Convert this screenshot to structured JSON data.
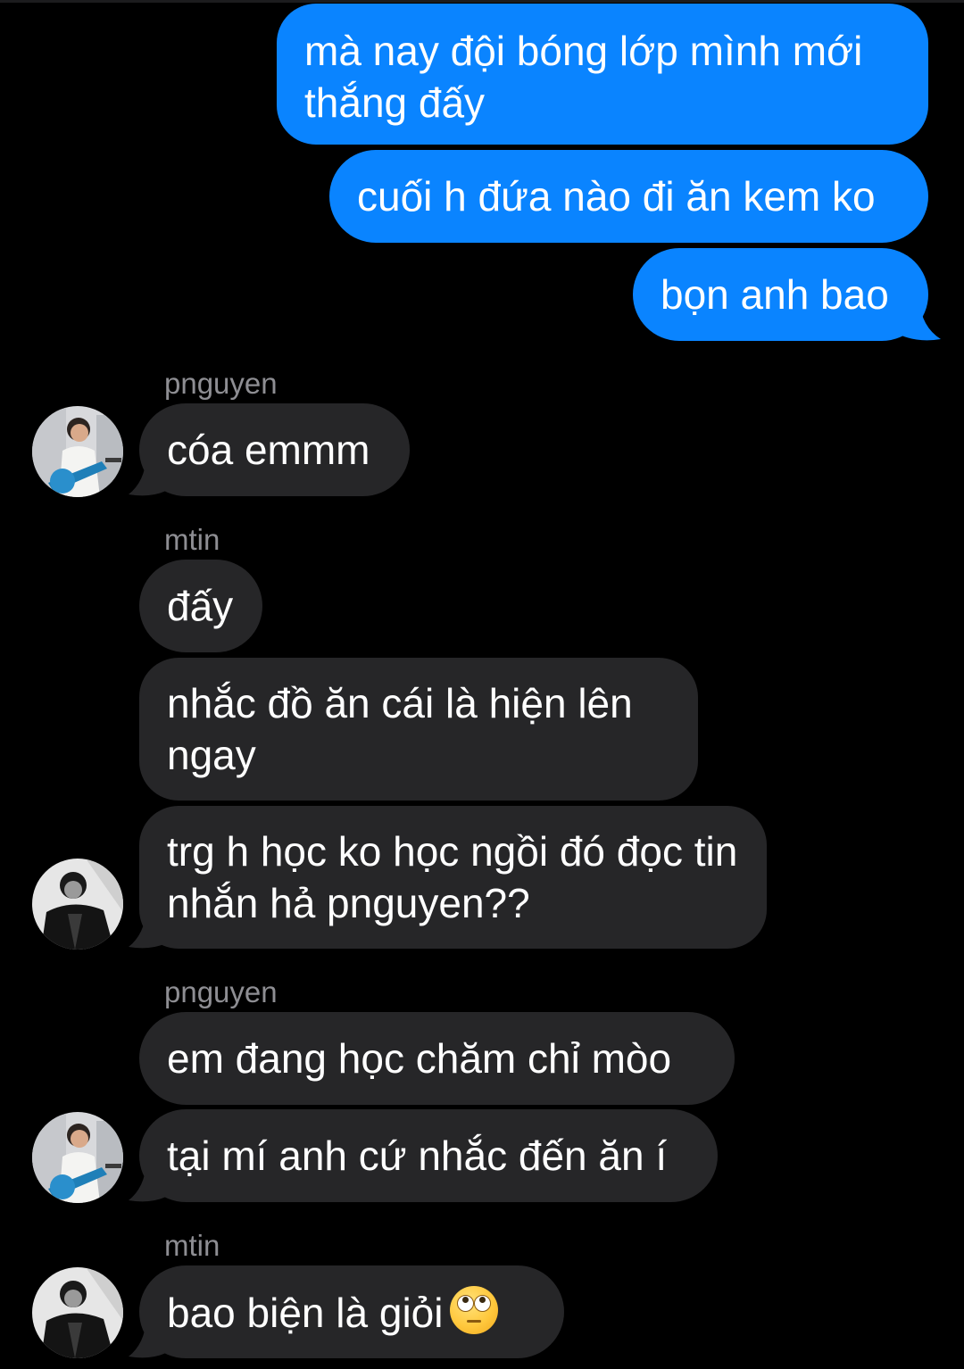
{
  "colors": {
    "outgoing": "#0a84ff",
    "incoming": "#262628",
    "background": "#000000",
    "sender": "#8e8e93"
  },
  "messages": {
    "m1": "mà nay đội bóng lớp mình mới thắng đấy",
    "m2": "cuối h đứa nào đi ăn kem ko",
    "m3": "bọn anh bao",
    "m4": "cóa emmm",
    "m5": "đấy",
    "m6": "nhắc đồ ăn cái là hiện lên ngay",
    "m7": "trg h học ko học ngồi đó đọc tin nhắn hả pnguyen??",
    "m8": "em đang học chăm chỉ mòo",
    "m9": "tại mí anh cứ nhắc đến ăn í",
    "m10": "bao biện là giỏi"
  },
  "senders": {
    "s1": "pnguyen",
    "s2": "mtin",
    "s3": "pnguyen",
    "s4": "mtin"
  },
  "icons": {
    "avatar_pnguyen": "avatar-guitar-photo",
    "avatar_mtin": "avatar-bw-photo",
    "emoji": "face-with-rolling-eyes"
  }
}
